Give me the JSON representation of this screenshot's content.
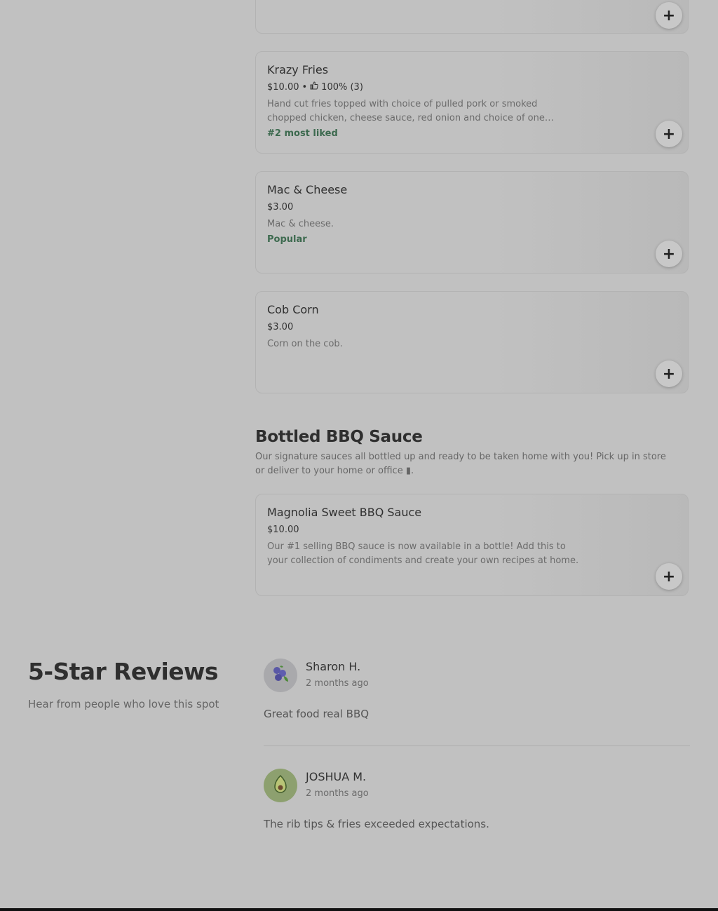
{
  "menu": {
    "items": [
      {
        "name": "",
        "meta": "",
        "desc": "",
        "tag": ""
      },
      {
        "name": "Krazy Fries",
        "price": "$10.00",
        "separator": "•",
        "rating": "100% (3)",
        "desc": "Hand cut fries topped with choice of pulled pork or smoked chopped chicken, cheese sauce, red onion and choice of one signature BBQ sauce.",
        "tag": "#2 most liked"
      },
      {
        "name": "Mac & Cheese",
        "price": "$3.00",
        "desc": "Mac & cheese.",
        "tag": "Popular"
      },
      {
        "name": "Cob Corn",
        "price": "$3.00",
        "desc": "Corn on the cob.",
        "tag": ""
      }
    ],
    "add_label": "+"
  },
  "bottled_section": {
    "title": "Bottled BBQ Sauce",
    "description": "Our signature sauces all bottled up and ready to be taken home with you! Pick up in store or deliver to your home or office ▮.",
    "items": [
      {
        "name": "Magnolia Sweet BBQ Sauce",
        "price": "$10.00",
        "desc": "Our #1 selling BBQ sauce is now available in a bottle! Add this to your collection of condiments and create your own recipes at home."
      }
    ]
  },
  "reviews": {
    "title": "5-Star Reviews",
    "subtitle": "Hear from people who love this spot",
    "list": [
      {
        "name": "Sharon H.",
        "time": "2 months ago",
        "text": "Great food real BBQ",
        "avatar_icon": "blueberry-icon"
      },
      {
        "name": "JOSHUA M.",
        "time": "2 months ago",
        "text": "The rib tips & fries exceeded expectations.",
        "avatar_icon": "avocado-icon"
      }
    ]
  },
  "colors": {
    "background": "#c1c1c1",
    "tag_green": "#3d6a4f",
    "footer": "#111111"
  }
}
